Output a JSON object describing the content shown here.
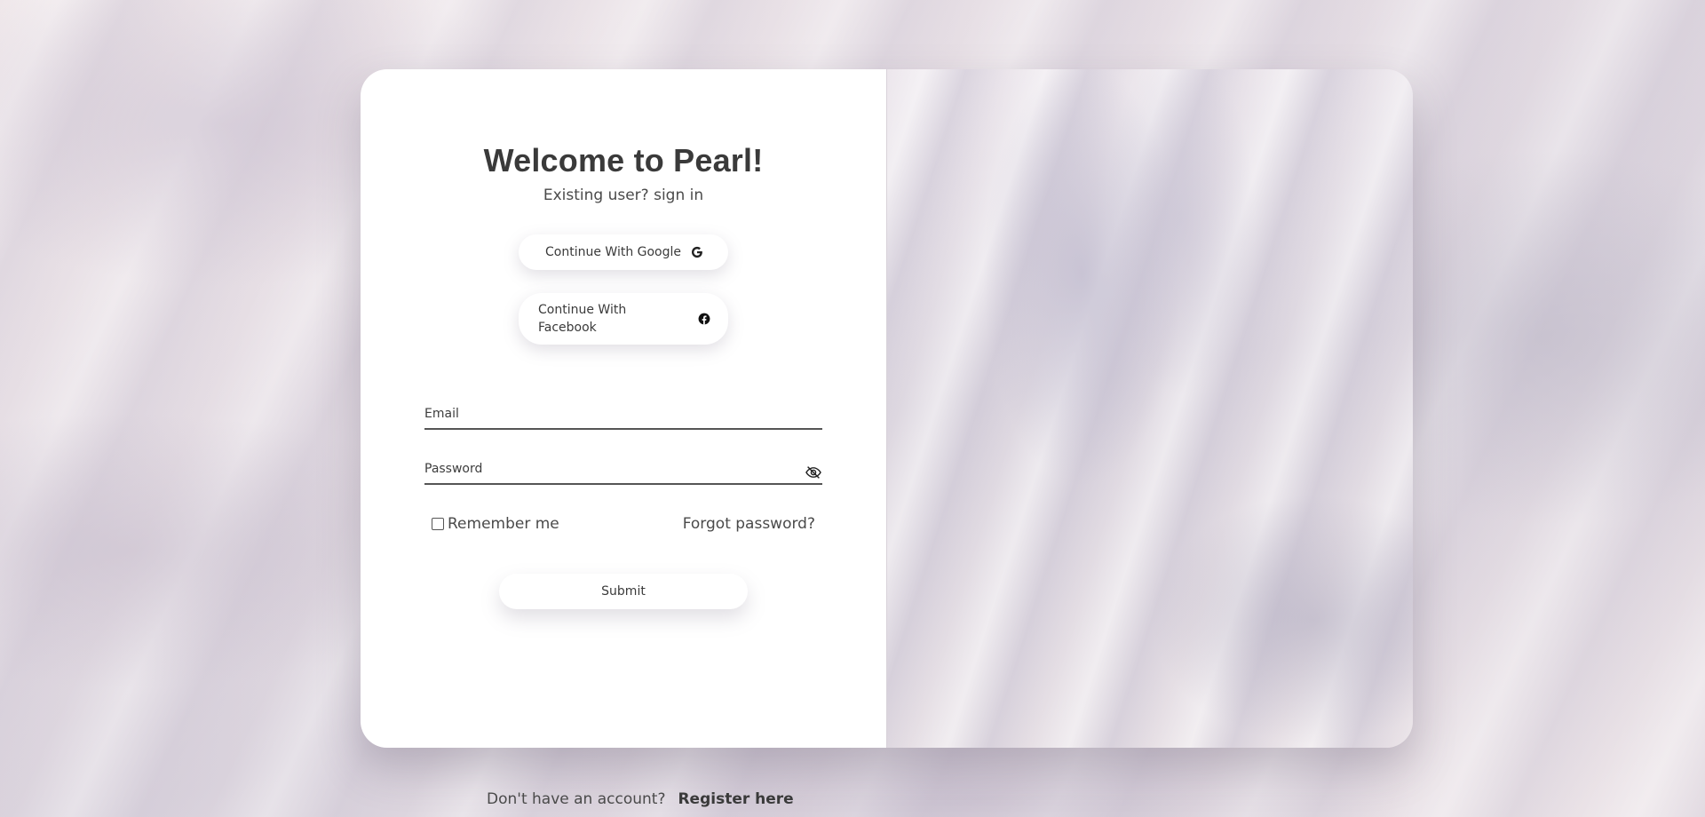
{
  "login": {
    "title": "Welcome to Pearl!",
    "subtitle": "Existing user? sign in",
    "google_button": "Continue With Google",
    "facebook_button": "Continue With Facebook",
    "email_placeholder": "Email",
    "password_placeholder": "Password",
    "remember_label": "Remember me",
    "remember_checked": false,
    "forgot_link": "Forgot password?",
    "submit_label": "Submit"
  },
  "footer": {
    "prompt": "Don't have an account?",
    "register_link": "Register here"
  },
  "icons": {
    "google": "google-g-icon",
    "facebook": "facebook-icon",
    "password_toggle": "eye-slash-icon"
  }
}
